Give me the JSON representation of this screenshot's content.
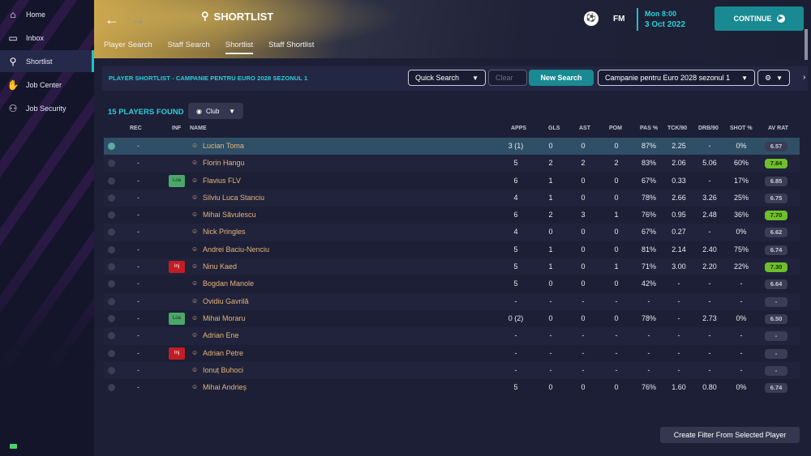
{
  "sidebar": {
    "items": [
      {
        "label": "Home",
        "icon": "home-icon",
        "glyph": "⌂"
      },
      {
        "label": "Inbox",
        "icon": "inbox-icon",
        "glyph": "▭"
      },
      {
        "label": "Shortlist",
        "icon": "search-icon",
        "glyph": "⚲"
      },
      {
        "label": "Job Center",
        "icon": "handshake-icon",
        "glyph": "✋"
      },
      {
        "label": "Job Security",
        "icon": "people-icon",
        "glyph": "⚇"
      }
    ]
  },
  "header": {
    "title": "SHORTLIST",
    "date_day": "Mon 8:00",
    "date": "3 Oct 2022",
    "fm_label": "FM",
    "continue_label": "CONTINUE",
    "tabs": [
      "Player Search",
      "Staff Search",
      "Shortlist",
      "Staff Shortlist"
    ]
  },
  "toolbar": {
    "title": "PLAYER SHORTLIST - CAMPANIE PENTRU EURO 2028 SEZONUL 1",
    "quick_search": "Quick Search",
    "clear": "Clear",
    "new_search": "New Search",
    "shortlist_select": "Campanie pentru Euro 2028 sezonul 1"
  },
  "list": {
    "found": "15 PLAYERS FOUND",
    "club_filter": "Club",
    "columns": {
      "rec": "REC",
      "inf": "INF",
      "name": "NAME",
      "apps": "APPS",
      "gls": "GLS",
      "ast": "AST",
      "pom": "POM",
      "pas": "PAS %",
      "tck": "TCK/90",
      "drb": "DRB/90",
      "shot": "SHOT %",
      "rat": "AV RAT"
    },
    "rows": [
      {
        "rec": "-",
        "inf": "",
        "name": "Lucian Toma",
        "apps": "3 (1)",
        "gls": "0",
        "ast": "0",
        "pom": "0",
        "pas": "87%",
        "tck": "2.25",
        "drb": "-",
        "shot": "0%",
        "rat": "6.57",
        "good": false
      },
      {
        "rec": "-",
        "inf": "",
        "name": "Florin Hangu",
        "apps": "5",
        "gls": "2",
        "ast": "2",
        "pom": "2",
        "pas": "83%",
        "tck": "2.06",
        "drb": "5.06",
        "shot": "60%",
        "rat": "7.84",
        "good": true
      },
      {
        "rec": "-",
        "inf": "Loa",
        "name": "Flavius FLV",
        "apps": "6",
        "gls": "1",
        "ast": "0",
        "pom": "0",
        "pas": "67%",
        "tck": "0.33",
        "drb": "-",
        "shot": "17%",
        "rat": "6.85",
        "good": false
      },
      {
        "rec": "-",
        "inf": "",
        "name": "Silviu Luca Stanciu",
        "apps": "4",
        "gls": "1",
        "ast": "0",
        "pom": "0",
        "pas": "78%",
        "tck": "2.66",
        "drb": "3.26",
        "shot": "25%",
        "rat": "6.75",
        "good": false
      },
      {
        "rec": "-",
        "inf": "",
        "name": "Mihai Săvulescu",
        "apps": "6",
        "gls": "2",
        "ast": "3",
        "pom": "1",
        "pas": "76%",
        "tck": "0.95",
        "drb": "2.48",
        "shot": "36%",
        "rat": "7.70",
        "good": true
      },
      {
        "rec": "-",
        "inf": "",
        "name": "Nick Pringles",
        "apps": "4",
        "gls": "0",
        "ast": "0",
        "pom": "0",
        "pas": "67%",
        "tck": "0.27",
        "drb": "-",
        "shot": "0%",
        "rat": "6.62",
        "good": false
      },
      {
        "rec": "-",
        "inf": "",
        "name": "Andrei Baciu-Nenciu",
        "apps": "5",
        "gls": "1",
        "ast": "0",
        "pom": "0",
        "pas": "81%",
        "tck": "2.14",
        "drb": "2.40",
        "shot": "75%",
        "rat": "6.74",
        "good": false
      },
      {
        "rec": "-",
        "inf": "Inj",
        "name": "Ninu Kaed",
        "apps": "5",
        "gls": "1",
        "ast": "0",
        "pom": "1",
        "pas": "71%",
        "tck": "3.00",
        "drb": "2.20",
        "shot": "22%",
        "rat": "7.30",
        "good": true
      },
      {
        "rec": "-",
        "inf": "",
        "name": "Bogdan Manole",
        "apps": "5",
        "gls": "0",
        "ast": "0",
        "pom": "0",
        "pas": "42%",
        "tck": "-",
        "drb": "-",
        "shot": "-",
        "rat": "6.64",
        "good": false
      },
      {
        "rec": "-",
        "inf": "",
        "name": "Ovidiu Gavrilă",
        "apps": "-",
        "gls": "-",
        "ast": "-",
        "pom": "-",
        "pas": "-",
        "tck": "-",
        "drb": "-",
        "shot": "-",
        "rat": "-",
        "good": false
      },
      {
        "rec": "-",
        "inf": "Loa",
        "name": "Mihai Moraru",
        "apps": "0 (2)",
        "gls": "0",
        "ast": "0",
        "pom": "0",
        "pas": "78%",
        "tck": "-",
        "drb": "2.73",
        "shot": "0%",
        "rat": "6.50",
        "good": false
      },
      {
        "rec": "-",
        "inf": "",
        "name": "Adrian Ene",
        "apps": "-",
        "gls": "-",
        "ast": "-",
        "pom": "-",
        "pas": "-",
        "tck": "-",
        "drb": "-",
        "shot": "-",
        "rat": "-",
        "good": false
      },
      {
        "rec": "-",
        "inf": "Inj",
        "name": "Adrian Petre",
        "apps": "-",
        "gls": "-",
        "ast": "-",
        "pom": "-",
        "pas": "-",
        "tck": "-",
        "drb": "-",
        "shot": "-",
        "rat": "-",
        "good": false
      },
      {
        "rec": "-",
        "inf": "",
        "name": "Ionuț Buhoci",
        "apps": "-",
        "gls": "-",
        "ast": "-",
        "pom": "-",
        "pas": "-",
        "tck": "-",
        "drb": "-",
        "shot": "-",
        "rat": "-",
        "good": false
      },
      {
        "rec": "-",
        "inf": "",
        "name": "Mihai Andrieș",
        "apps": "5",
        "gls": "0",
        "ast": "0",
        "pom": "0",
        "pas": "76%",
        "tck": "1.60",
        "drb": "0.80",
        "shot": "0%",
        "rat": "6.74",
        "good": false
      }
    ]
  },
  "footer": {
    "filter_button": "Create Filter From Selected Player"
  },
  "colors": {
    "accent": "#20c0c8",
    "continue": "#1a8a92",
    "good_rating": "#6fbf2a",
    "loan": "#4aa86a",
    "injury": "#c21d24"
  }
}
